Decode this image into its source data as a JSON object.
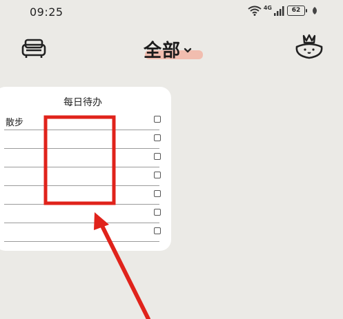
{
  "status_bar": {
    "time": "09:25",
    "network_label": "4G",
    "battery_level": "62"
  },
  "header": {
    "title": "全部",
    "left_icon": "sofa-icon",
    "right_icon": "crown-cat-icon",
    "accent_color": "#f2b8a8"
  },
  "widget": {
    "title": "每日待办",
    "rows": [
      {
        "text": "散步",
        "checked": false
      },
      {
        "text": "",
        "checked": false
      },
      {
        "text": "",
        "checked": false
      },
      {
        "text": "",
        "checked": false
      },
      {
        "text": "",
        "checked": false
      },
      {
        "text": "",
        "checked": false
      },
      {
        "text": "",
        "checked": false
      }
    ]
  },
  "annotation": {
    "highlight_color": "#e0231b"
  }
}
